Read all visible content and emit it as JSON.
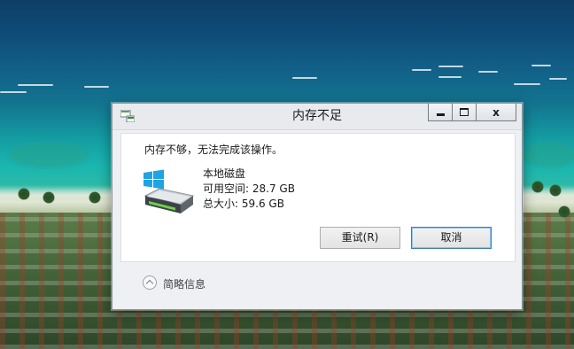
{
  "window": {
    "title": "内存不足",
    "controls": {
      "minimize": "minimize-icon",
      "maximize": "maximize-icon",
      "close": "x"
    }
  },
  "message": "内存不够，无法完成该操作。",
  "drive": {
    "icon": "hard-drive-icon",
    "name": "本地磁盘",
    "free_space": "可用空间: 28.7 GB",
    "total_size": "总大小: 59.6 GB"
  },
  "buttons": {
    "retry": "重试(R)",
    "cancel": "取消"
  },
  "details_toggle": "简略信息",
  "colors": {
    "windows_logo": "#1fa3e3",
    "dialog_bg": "#eef0f3",
    "accent_border": "#3c7fb1"
  }
}
